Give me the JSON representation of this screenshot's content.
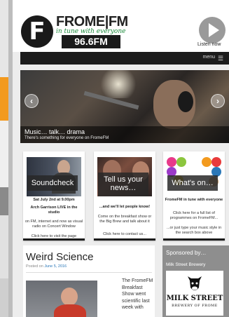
{
  "header": {
    "logo_letter": "F",
    "brand": "FROME|FM",
    "tagline": "in tune with everyone",
    "frequency": "96.6FM",
    "listen_label": "Listen now"
  },
  "menubar": {
    "label": "menu"
  },
  "slider": {
    "caption_title": "Music… talk… drama",
    "caption_sub": "There's something for everyone on FromeFM",
    "prev": "‹",
    "next": "›"
  },
  "cards": [
    {
      "title": "Soundcheck",
      "date": "Sat July 2nd at 9.00pm",
      "lead": "Arch Garrison LIVE in the studio",
      "body": "on FM, internet and now as visual radio on Concert Window",
      "link": "Click here to visit the page"
    },
    {
      "title": "Tell us your news…",
      "lead": "...and we'll let people know!",
      "body": "Come on the breakfast show or the Big Brew and talk about it",
      "link": "Click here to contact us..."
    },
    {
      "title": "What's on…",
      "lead": "FromeFM in tune with everyone",
      "body": "Click here for a full list of programmes on FromeFM...",
      "link": "...or just type your music style in the search box above"
    }
  ],
  "post": {
    "title": "Weird Science",
    "meta_prefix": "Posted on",
    "date": "June 5, 2016",
    "excerpt": "The FromeFM Breakfast Show went scientific last week with"
  },
  "sponsor": {
    "heading": "Sponsored by…",
    "name": "Milk Street Brewery",
    "logo_main": "MILK STREET",
    "logo_sub": "BREWERY OF FROME"
  },
  "colors": {
    "accent_orange": "#f39a1e",
    "tagline_green": "#1a8a3a",
    "link_blue": "#2b78b8",
    "menubar": "#1c1c1c"
  }
}
